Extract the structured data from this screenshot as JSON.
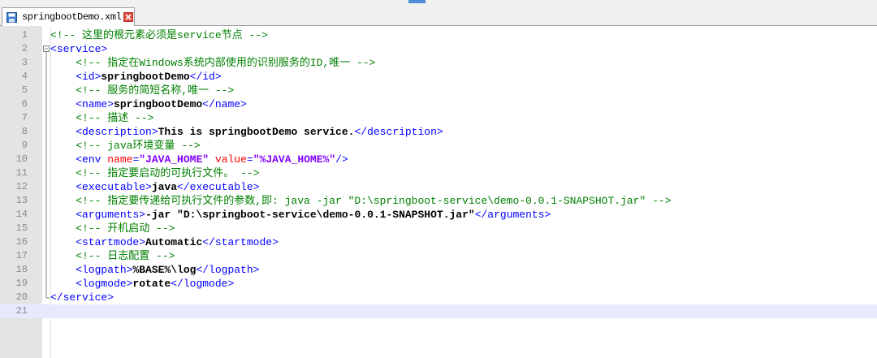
{
  "tab": {
    "filename": "springbootDemo.xml",
    "file_icon": "save-disk-icon",
    "close_icon": "close-icon"
  },
  "colors": {
    "comment": "#008000",
    "tag": "#0000ff",
    "attribute": "#ff0000",
    "attribute_value": "#8000ff",
    "text": "#000000",
    "gutter_bg": "#e4e4e4",
    "current_line": "#e8e8ff"
  },
  "editor": {
    "current_line": 21,
    "lines": [
      {
        "num": "1",
        "fold": "none",
        "tokens": [
          {
            "t": "cmt",
            "v": "<!-- 这里的根元素必须是service节点 -->"
          }
        ]
      },
      {
        "num": "2",
        "fold": "start",
        "tokens": [
          {
            "t": "tag",
            "v": "<service>"
          }
        ]
      },
      {
        "num": "3",
        "fold": "line",
        "tokens": [
          {
            "t": "cmt",
            "v": "    <!-- 指定在Windows系统内部使用的识别服务的ID,唯一 -->"
          }
        ]
      },
      {
        "num": "4",
        "fold": "line",
        "tokens": [
          {
            "t": "tag",
            "v": "    <id>"
          },
          {
            "t": "txt",
            "v": "springbootDemo"
          },
          {
            "t": "tag",
            "v": "</id>"
          }
        ]
      },
      {
        "num": "5",
        "fold": "line",
        "tokens": [
          {
            "t": "cmt",
            "v": "    <!-- 服务的简短名称,唯一 -->"
          }
        ]
      },
      {
        "num": "6",
        "fold": "line",
        "tokens": [
          {
            "t": "tag",
            "v": "    <name>"
          },
          {
            "t": "txt",
            "v": "springbootDemo"
          },
          {
            "t": "tag",
            "v": "</name>"
          }
        ]
      },
      {
        "num": "7",
        "fold": "line",
        "tokens": [
          {
            "t": "cmt",
            "v": "    <!-- 描述 -->"
          }
        ]
      },
      {
        "num": "8",
        "fold": "line",
        "tokens": [
          {
            "t": "tag",
            "v": "    <description>"
          },
          {
            "t": "txt",
            "v": "This is springbootDemo service."
          },
          {
            "t": "tag",
            "v": "</description>"
          }
        ]
      },
      {
        "num": "9",
        "fold": "line",
        "tokens": [
          {
            "t": "cmt",
            "v": "    <!-- java环境变量 -->"
          }
        ]
      },
      {
        "num": "10",
        "fold": "line",
        "tokens": [
          {
            "t": "tag",
            "v": "    <env "
          },
          {
            "t": "attr",
            "v": "name"
          },
          {
            "t": "tag",
            "v": "="
          },
          {
            "t": "val",
            "v": "\"JAVA_HOME\""
          },
          {
            "t": "tag",
            "v": " "
          },
          {
            "t": "attr",
            "v": "value"
          },
          {
            "t": "tag",
            "v": "="
          },
          {
            "t": "val",
            "v": "\"%JAVA_HOME%\""
          },
          {
            "t": "tag",
            "v": "/>"
          }
        ]
      },
      {
        "num": "11",
        "fold": "line",
        "tokens": [
          {
            "t": "cmt",
            "v": "    <!-- 指定要启动的可执行文件。 -->"
          }
        ]
      },
      {
        "num": "12",
        "fold": "line",
        "tokens": [
          {
            "t": "tag",
            "v": "    <executable>"
          },
          {
            "t": "txt",
            "v": "java"
          },
          {
            "t": "tag",
            "v": "</executable>"
          }
        ]
      },
      {
        "num": "13",
        "fold": "line",
        "tokens": [
          {
            "t": "cmt",
            "v": "    <!-- 指定要传递给可执行文件的参数,即: java -jar \"D:\\springboot-service\\demo-0.0.1-SNAPSHOT.jar\" -->"
          }
        ]
      },
      {
        "num": "14",
        "fold": "line",
        "tokens": [
          {
            "t": "tag",
            "v": "    <arguments>"
          },
          {
            "t": "txt",
            "v": "-jar \"D:\\springboot-service\\demo-0.0.1-SNAPSHOT.jar\""
          },
          {
            "t": "tag",
            "v": "</arguments>"
          }
        ]
      },
      {
        "num": "15",
        "fold": "line",
        "tokens": [
          {
            "t": "cmt",
            "v": "    <!-- 开机启动 -->"
          }
        ]
      },
      {
        "num": "16",
        "fold": "line",
        "tokens": [
          {
            "t": "tag",
            "v": "    <startmode>"
          },
          {
            "t": "txt",
            "v": "Automatic"
          },
          {
            "t": "tag",
            "v": "</startmode>"
          }
        ]
      },
      {
        "num": "17",
        "fold": "line",
        "tokens": [
          {
            "t": "cmt",
            "v": "    <!-- 日志配置 -->"
          }
        ]
      },
      {
        "num": "18",
        "fold": "line",
        "tokens": [
          {
            "t": "tag",
            "v": "    <logpath>"
          },
          {
            "t": "txt",
            "v": "%BASE%\\log"
          },
          {
            "t": "tag",
            "v": "</logpath>"
          }
        ]
      },
      {
        "num": "19",
        "fold": "line",
        "tokens": [
          {
            "t": "tag",
            "v": "    <logmode>"
          },
          {
            "t": "txt",
            "v": "rotate"
          },
          {
            "t": "tag",
            "v": "</logmode>"
          }
        ]
      },
      {
        "num": "20",
        "fold": "end",
        "tokens": [
          {
            "t": "tag",
            "v": "</service>"
          }
        ]
      },
      {
        "num": "21",
        "fold": "none",
        "tokens": []
      }
    ]
  }
}
